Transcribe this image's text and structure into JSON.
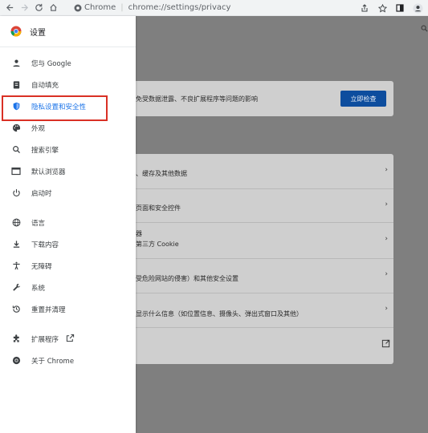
{
  "browser": {
    "chip_label": "Chrome",
    "url": "chrome://settings/privacy"
  },
  "drawer": {
    "title": "设置",
    "items": [
      {
        "label": "您与 Google"
      },
      {
        "label": "自动填充"
      },
      {
        "label": "隐私设置和安全性"
      },
      {
        "label": "外观"
      },
      {
        "label": "搜索引擎"
      },
      {
        "label": "默认浏览器"
      },
      {
        "label": "启动时"
      },
      {
        "label": "语言"
      },
      {
        "label": "下载内容"
      },
      {
        "label": "无障碍"
      },
      {
        "label": "系统"
      },
      {
        "label": "重置并清理"
      },
      {
        "label": "扩展程序"
      },
      {
        "label": "关于 Chrome"
      }
    ]
  },
  "content": {
    "safety_text": "免受数据泄露、不良扩展程序等问题的影响",
    "check_button": "立即检查",
    "rows": [
      {
        "line1": "、缓存及其他数据"
      },
      {
        "line1": "页面和安全控件"
      },
      {
        "line1": "器",
        "line2": "第三方 Cookie"
      },
      {
        "line1": "受危险网站的侵害）和其他安全设置"
      },
      {
        "line1": "显示什么信息（如位置信息、摄像头、弹出式窗口及其他）"
      }
    ]
  },
  "colors": {
    "accent": "#1a73e8",
    "highlight_border": "#d93025",
    "overlay": "#7f7f7f"
  }
}
